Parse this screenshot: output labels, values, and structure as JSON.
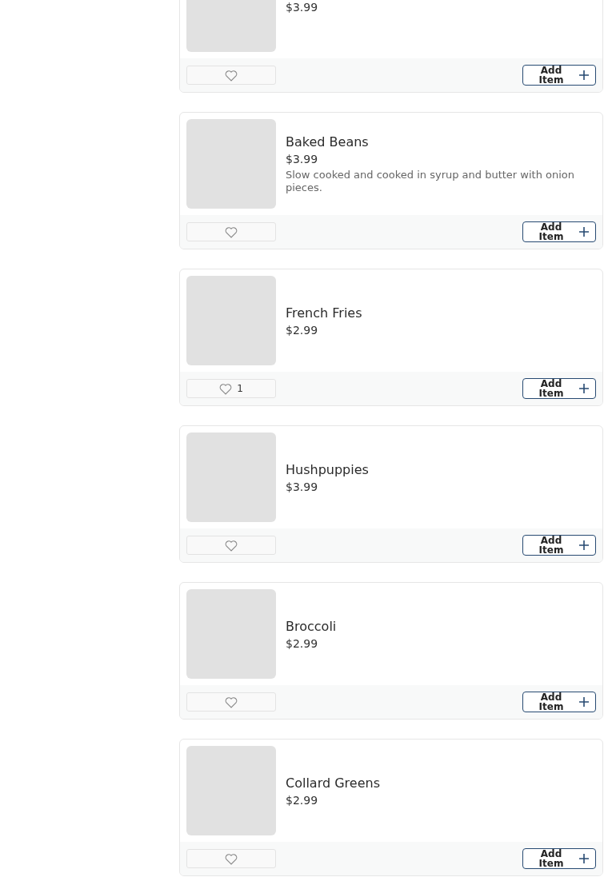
{
  "items": [
    {
      "price": "$3.99",
      "button": "Add Item"
    },
    {
      "name": "Baked Beans",
      "price": "$3.99",
      "description": "Slow cooked and cooked in syrup and butter with onion pieces.",
      "button": "Add Item"
    },
    {
      "name": "French Fries",
      "price": "$2.99",
      "likes": "1",
      "button": "Add Item"
    },
    {
      "name": "Hushpuppies",
      "price": "$3.99",
      "button": "Add Item"
    },
    {
      "name": "Broccoli",
      "price": "$2.99",
      "button": "Add Item"
    },
    {
      "name": "Collard Greens",
      "price": "$2.99",
      "button": "Add Item"
    }
  ]
}
